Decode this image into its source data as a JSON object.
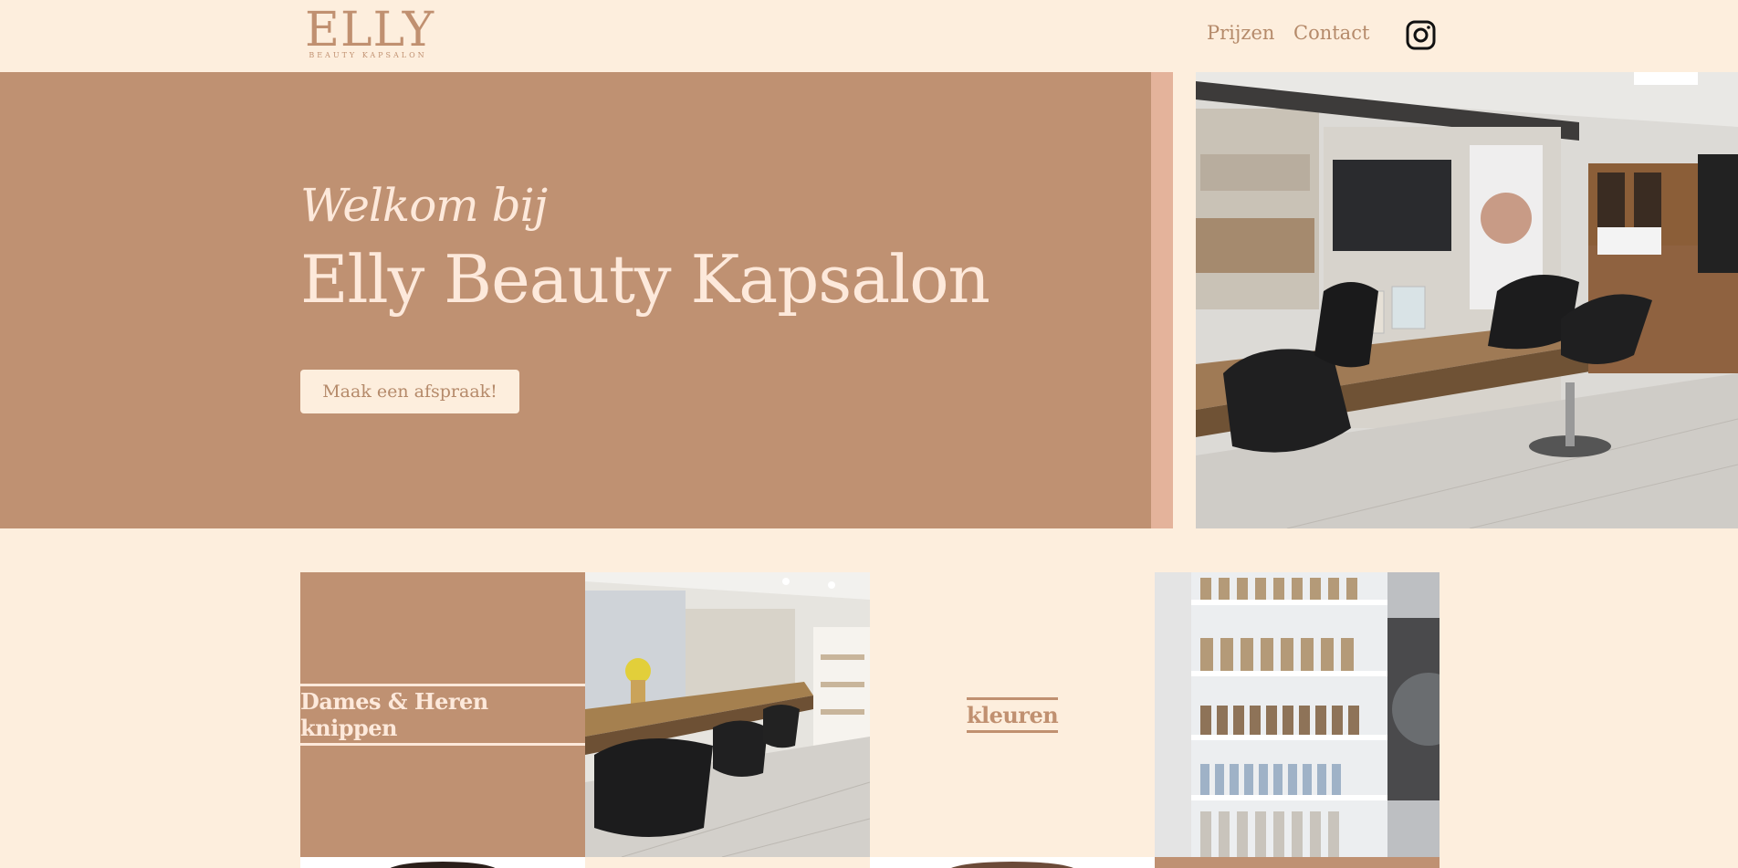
{
  "header": {
    "logo_main": "ELLY",
    "logo_sub": "BEAUTY KAPSALON",
    "nav": {
      "prijzen": "Prijzen",
      "contact": "Contact"
    },
    "social_icon": "instagram-icon"
  },
  "hero": {
    "welcome": "Welkom bij",
    "title": "Elly Beauty Kapsalon",
    "cta_label": "Maak een afspraak!"
  },
  "services": {
    "knippen": "Dames & Heren knippen",
    "kleuren": "kleuren"
  },
  "colors": {
    "background": "#fdeedd",
    "brand_brown": "#bf9172",
    "accent_pink": "#e4b39b",
    "cream_text": "#fde9db"
  }
}
